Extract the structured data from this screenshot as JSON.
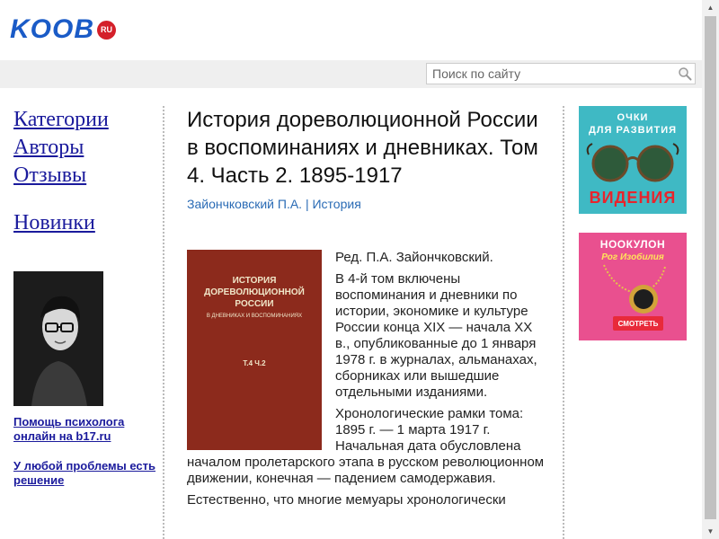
{
  "header": {
    "logo_text": "KOOB",
    "logo_badge": "RU"
  },
  "search": {
    "placeholder": "Поиск по сайту"
  },
  "nav": {
    "categories": "Категории",
    "authors": "Авторы",
    "reviews": "Отзывы",
    "new": "Новинки"
  },
  "promo": {
    "link1": "Помощь психолога онлайн на b17.ru",
    "link2": "У любой проблемы есть решение"
  },
  "book": {
    "title": "История дореволюционной России в воспоминаниях и дневниках. Том 4. Часть 2. 1895-1917",
    "author": "Зайончковский П.А.",
    "separator": " | ",
    "category": "История",
    "cover_title": "ИСТОРИЯ ДОРЕВОЛЮЦИОННОЙ РОССИИ",
    "cover_subtitle": "В ДНЕВНИКАХ И ВОСПОМИНАНИЯХ",
    "cover_volume": "Т.4 Ч.2",
    "para1": "Ред. П.А. Зайончковский.",
    "para2": "В 4-й том включены воспоминания и дневники по истории, экономике и культуре России конца XIX — начала XX в., опубликованные до 1 января 1978 г. в журналах, альманахах, сборниках или вышедшие отдельными изданиями.",
    "para3": "Хронологические рамки тома: 1895 г. — 1 марта 1917 г. Начальная дата обусловлена началом пролетарского этапа в русском революционном движении, конечная — падением самодержавия.",
    "para4": "Естественно, что многие мемуары хронологически"
  },
  "ads": {
    "ad1_line1": "ОЧКИ",
    "ad1_line2": "ДЛЯ РАЗВИТИЯ",
    "ad1_line3": "ВИДЕНИЯ",
    "ad2_line1": "НООКУЛОН",
    "ad2_line2": "Рог Изобилия",
    "ad2_button": "СМОТРЕТЬ"
  },
  "colors": {
    "brand_blue": "#1a5bc7",
    "badge_red": "#d4202a",
    "link_blue": "#1a1a9c",
    "meta_blue": "#2a6bb5"
  }
}
